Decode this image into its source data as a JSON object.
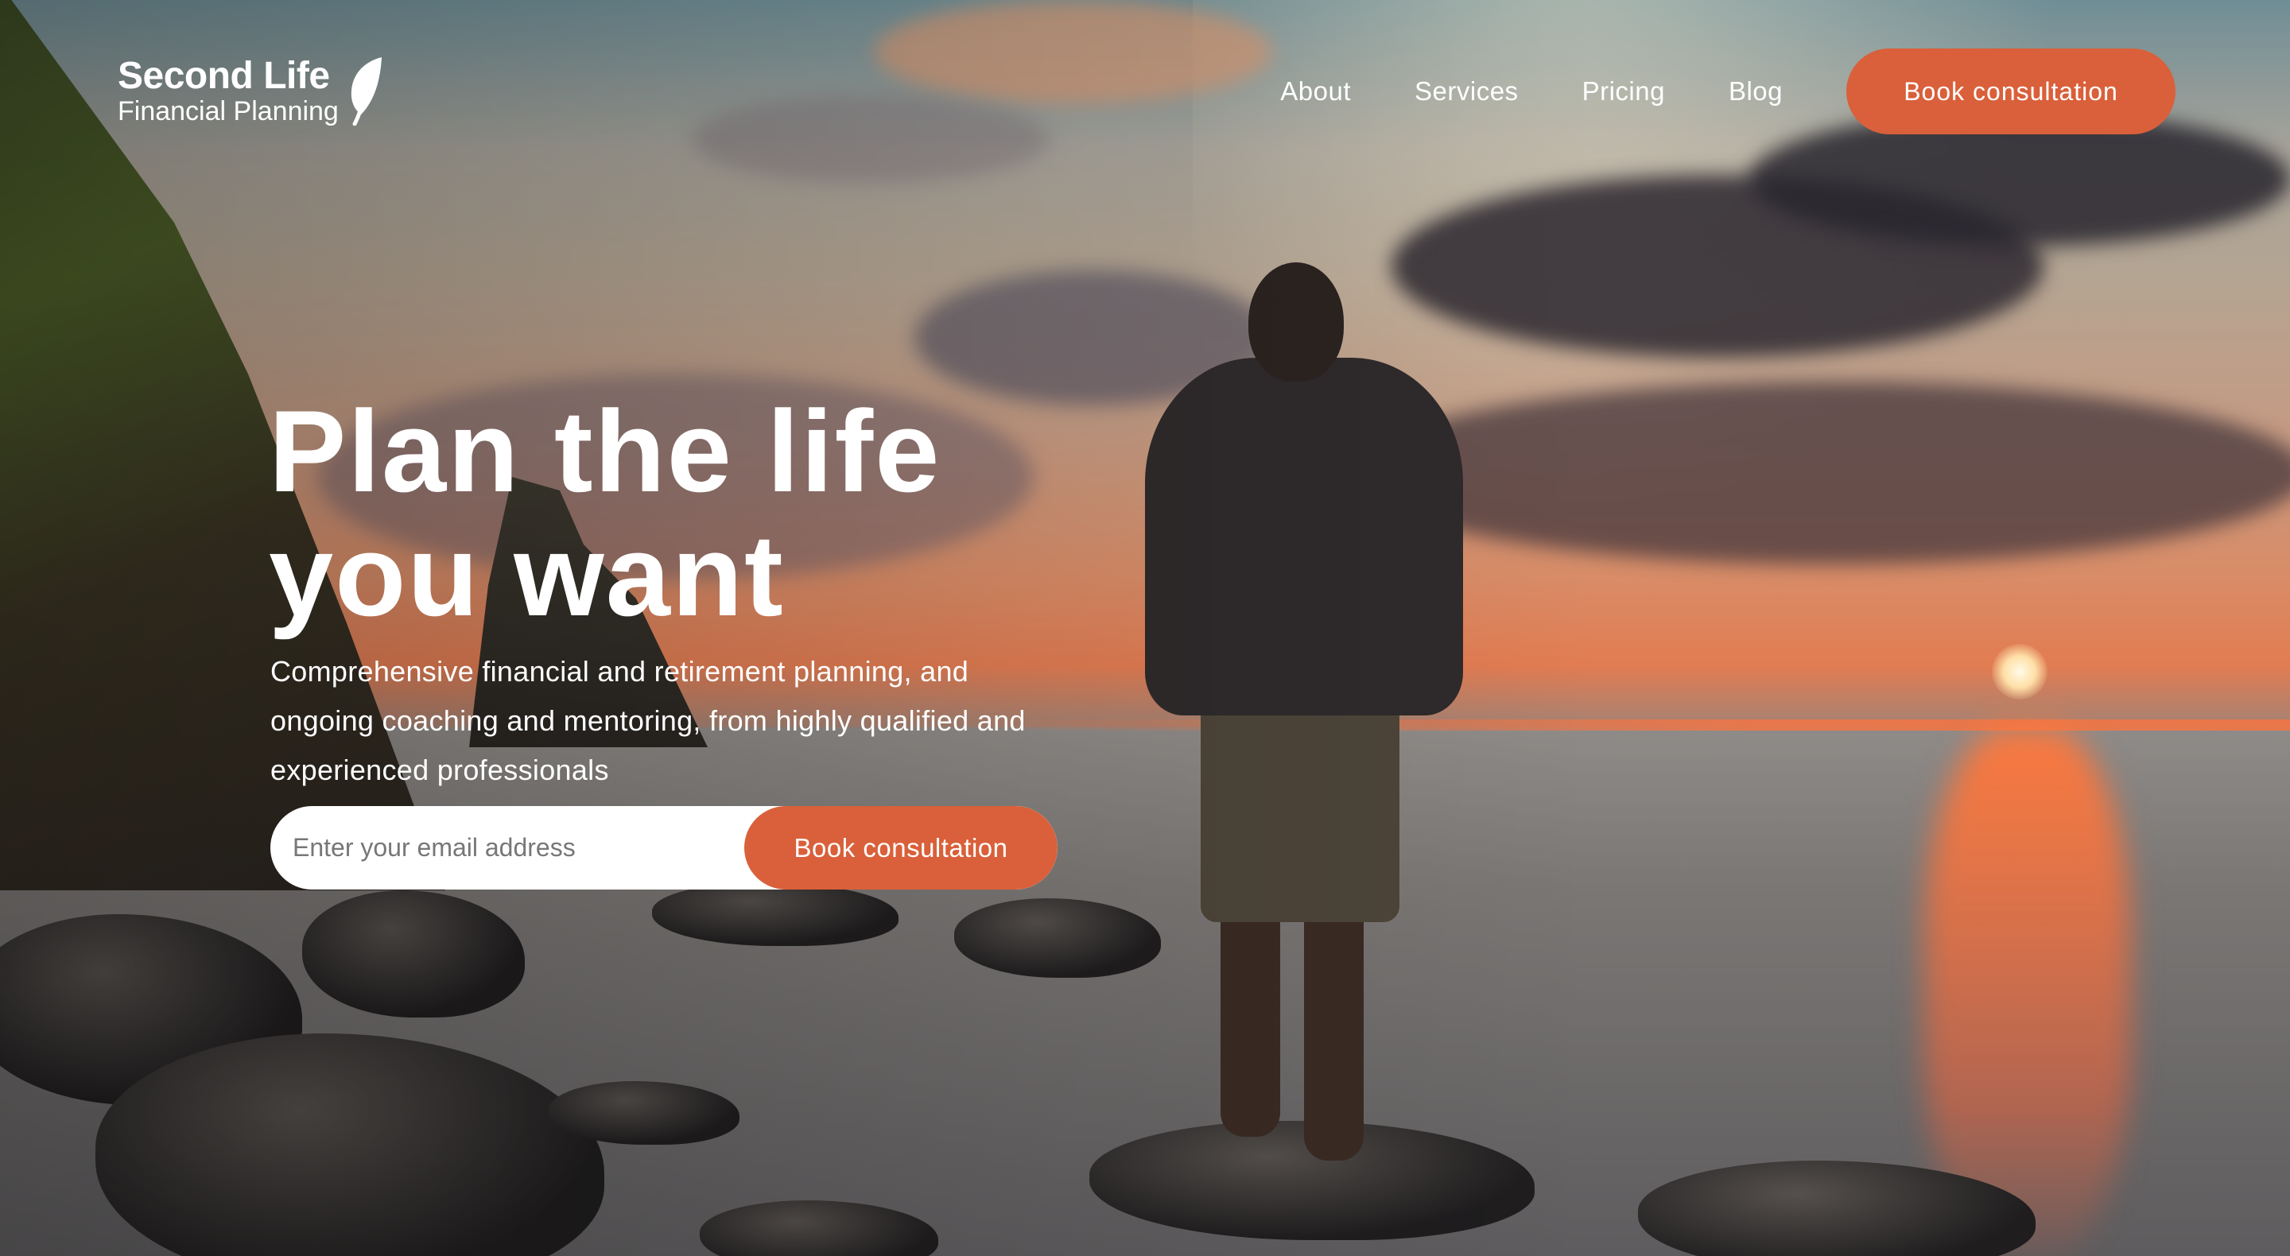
{
  "brand": {
    "name_line1": "Second Life",
    "name_line2": "Financial Planning",
    "logo_icon": "leaf-icon"
  },
  "nav": {
    "links": [
      "About",
      "Services",
      "Pricing",
      "Blog"
    ],
    "cta_label": "Book consultation"
  },
  "hero": {
    "headline_line1": "Plan the life",
    "headline_line2": "you want",
    "subheading": "Comprehensive financial and retirement planning, and ongoing coaching and mentoring, from highly qualified and experienced professionals",
    "email_placeholder": "Enter your email address",
    "submit_label": "Book consultation"
  },
  "colors": {
    "accent": "#d9603a",
    "text_on_image": "#ffffff"
  }
}
